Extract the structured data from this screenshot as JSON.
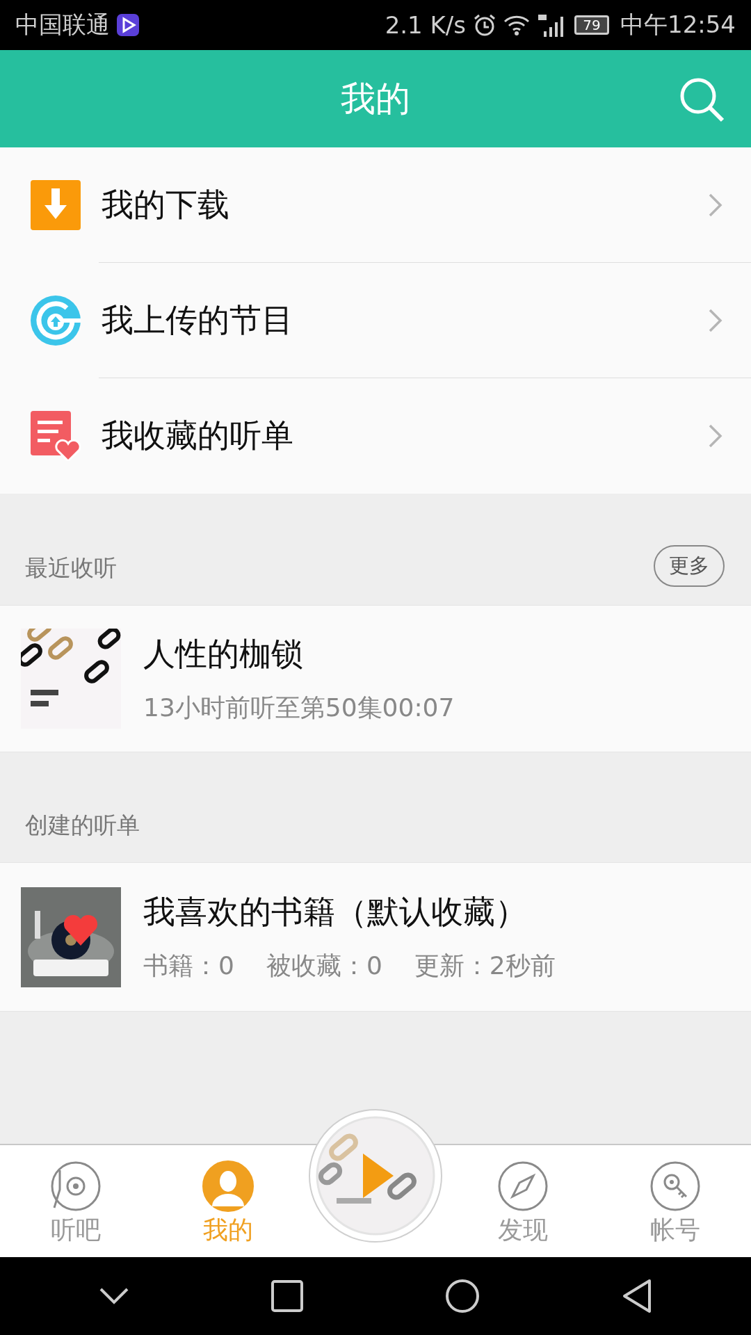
{
  "status_bar": {
    "carrier": "中国联通",
    "speed": "2.1 K/s",
    "battery": "79",
    "time": "中午12:54"
  },
  "header": {
    "title": "我的"
  },
  "menu": [
    {
      "kind": "download",
      "label": "我的下载"
    },
    {
      "kind": "upload",
      "label": "我上传的节目"
    },
    {
      "kind": "favorites",
      "label": "我收藏的听单"
    }
  ],
  "recent": {
    "title": "最近收听",
    "more": "更多",
    "items": [
      {
        "kind": "picture",
        "title": "人性的枷锁",
        "subtitle": "13小时前听至第50集00:07"
      }
    ]
  },
  "playlists": {
    "title": "创建的听单",
    "items": [
      {
        "kind": "picture",
        "title": "我喜欢的书籍（默认收藏）",
        "stats": [
          "书籍：0",
          "被收藏：0",
          "更新：2秒前"
        ]
      }
    ]
  },
  "tab_bar": [
    {
      "kind": "listen",
      "label": "听吧",
      "selected": false
    },
    {
      "kind": "me",
      "label": "我的",
      "selected": true
    },
    {
      "kind": "player"
    },
    {
      "kind": "discover",
      "label": "发现",
      "selected": false
    },
    {
      "kind": "account",
      "label": "帐号",
      "selected": false
    }
  ]
}
